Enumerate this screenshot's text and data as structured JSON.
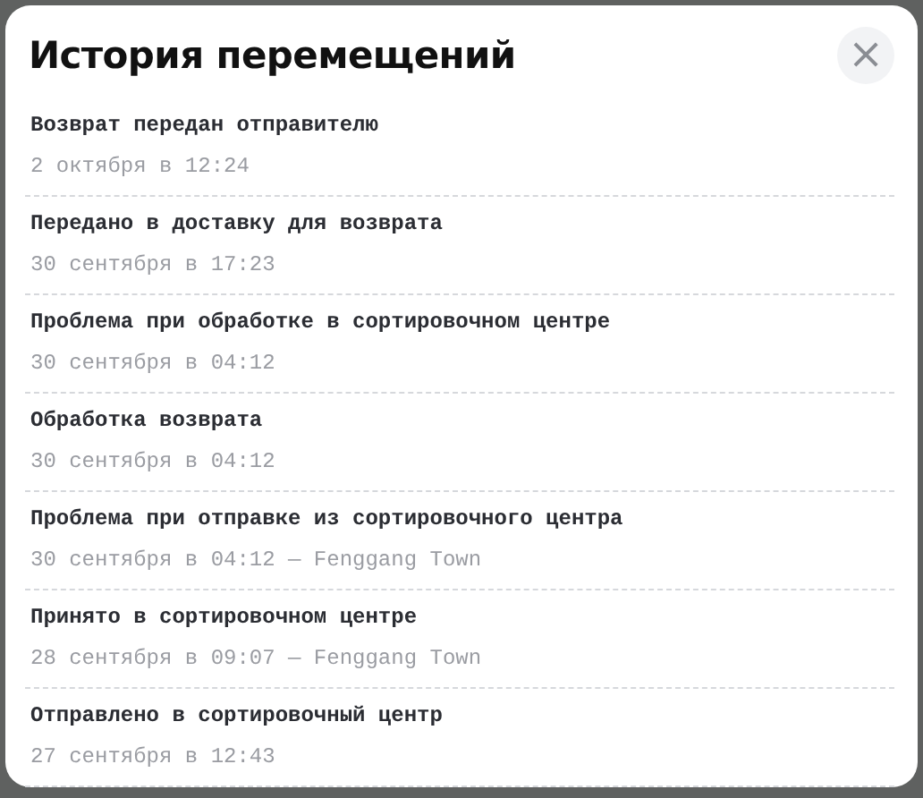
{
  "dialog": {
    "title": "История перемещений",
    "close_label": "×"
  },
  "events": [
    {
      "status": "Возврат передан отправителю",
      "time": "2 октября в 12:24"
    },
    {
      "status": "Передано в доставку для возврата",
      "time": "30 сентября в 17:23"
    },
    {
      "status": "Проблема при обработке в сортировочном центре",
      "time": "30 сентября в 04:12"
    },
    {
      "status": "Обработка возврата",
      "time": "30 сентября в 04:12"
    },
    {
      "status": "Проблема при отправке из сортировочного центра",
      "time": "30 сентября в 04:12 — Fenggang Town"
    },
    {
      "status": "Принято в сортировочном центре",
      "time": "28 сентября в 09:07 — Fenggang Town"
    },
    {
      "status": "Отправлено в сортировочный центр",
      "time": "27 сентября в 12:43"
    }
  ]
}
